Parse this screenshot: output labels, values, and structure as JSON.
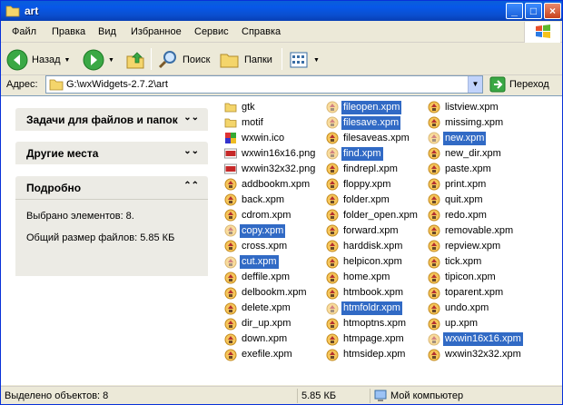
{
  "window": {
    "title": "art"
  },
  "menu": [
    "Файл",
    "Правка",
    "Вид",
    "Избранное",
    "Сервис",
    "Справка"
  ],
  "toolbar": {
    "back": "Назад",
    "search": "Поиск",
    "folders": "Папки"
  },
  "address": {
    "label": "Адрес:",
    "path": "G:\\wxWidgets-2.7.2\\art",
    "go": "Переход"
  },
  "taskpane": {
    "tasks": "Задачи для файлов и папок",
    "places": "Другие места",
    "details": "Подробно",
    "selected": "Выбрано элементов: 8.",
    "size": "Общий размер файлов: 5.85 КБ"
  },
  "files": {
    "col1": [
      {
        "name": "gtk",
        "type": "folder",
        "sel": false
      },
      {
        "name": "motif",
        "type": "folder",
        "sel": false
      },
      {
        "name": "wxwin.ico",
        "type": "ico",
        "sel": false
      },
      {
        "name": "wxwin16x16.png",
        "type": "png",
        "sel": false
      },
      {
        "name": "wxwin32x32.png",
        "type": "png",
        "sel": false
      },
      {
        "name": "addbookm.xpm",
        "type": "xpm",
        "sel": false
      },
      {
        "name": "back.xpm",
        "type": "xpm",
        "sel": false
      },
      {
        "name": "cdrom.xpm",
        "type": "xpm",
        "sel": false
      },
      {
        "name": "copy.xpm",
        "type": "xpm",
        "sel": true
      },
      {
        "name": "cross.xpm",
        "type": "xpm",
        "sel": false
      },
      {
        "name": "cut.xpm",
        "type": "xpm",
        "sel": true
      },
      {
        "name": "deffile.xpm",
        "type": "xpm",
        "sel": false
      },
      {
        "name": "delbookm.xpm",
        "type": "xpm",
        "sel": false
      },
      {
        "name": "delete.xpm",
        "type": "xpm",
        "sel": false
      },
      {
        "name": "dir_up.xpm",
        "type": "xpm",
        "sel": false
      },
      {
        "name": "down.xpm",
        "type": "xpm",
        "sel": false
      },
      {
        "name": "exefile.xpm",
        "type": "xpm",
        "sel": false
      }
    ],
    "col2": [
      {
        "name": "fileopen.xpm",
        "type": "xpm",
        "sel": true
      },
      {
        "name": "filesave.xpm",
        "type": "xpm",
        "sel": true
      },
      {
        "name": "filesaveas.xpm",
        "type": "xpm",
        "sel": false
      },
      {
        "name": "find.xpm",
        "type": "xpm",
        "sel": true
      },
      {
        "name": "findrepl.xpm",
        "type": "xpm",
        "sel": false
      },
      {
        "name": "floppy.xpm",
        "type": "xpm",
        "sel": false
      },
      {
        "name": "folder.xpm",
        "type": "xpm",
        "sel": false
      },
      {
        "name": "folder_open.xpm",
        "type": "xpm",
        "sel": false
      },
      {
        "name": "forward.xpm",
        "type": "xpm",
        "sel": false
      },
      {
        "name": "harddisk.xpm",
        "type": "xpm",
        "sel": false
      },
      {
        "name": "helpicon.xpm",
        "type": "xpm",
        "sel": false
      },
      {
        "name": "home.xpm",
        "type": "xpm",
        "sel": false
      },
      {
        "name": "htmbook.xpm",
        "type": "xpm",
        "sel": false
      },
      {
        "name": "htmfoldr.xpm",
        "type": "xpm",
        "sel": true
      },
      {
        "name": "htmoptns.xpm",
        "type": "xpm",
        "sel": false
      },
      {
        "name": "htmpage.xpm",
        "type": "xpm",
        "sel": false
      },
      {
        "name": "htmsidep.xpm",
        "type": "xpm",
        "sel": false
      }
    ],
    "col3": [
      {
        "name": "listview.xpm",
        "type": "xpm",
        "sel": false
      },
      {
        "name": "missimg.xpm",
        "type": "xpm",
        "sel": false
      },
      {
        "name": "new.xpm",
        "type": "xpm",
        "sel": true
      },
      {
        "name": "new_dir.xpm",
        "type": "xpm",
        "sel": false
      },
      {
        "name": "paste.xpm",
        "type": "xpm",
        "sel": false
      },
      {
        "name": "print.xpm",
        "type": "xpm",
        "sel": false
      },
      {
        "name": "quit.xpm",
        "type": "xpm",
        "sel": false
      },
      {
        "name": "redo.xpm",
        "type": "xpm",
        "sel": false
      },
      {
        "name": "removable.xpm",
        "type": "xpm",
        "sel": false
      },
      {
        "name": "repview.xpm",
        "type": "xpm",
        "sel": false
      },
      {
        "name": "tick.xpm",
        "type": "xpm",
        "sel": false
      },
      {
        "name": "tipicon.xpm",
        "type": "xpm",
        "sel": false
      },
      {
        "name": "toparent.xpm",
        "type": "xpm",
        "sel": false
      },
      {
        "name": "undo.xpm",
        "type": "xpm",
        "sel": false
      },
      {
        "name": "up.xpm",
        "type": "xpm",
        "sel": false
      },
      {
        "name": "wxwin16x16.xpm",
        "type": "xpm",
        "sel": true
      },
      {
        "name": "wxwin32x32.xpm",
        "type": "xpm",
        "sel": false
      }
    ]
  },
  "status": {
    "selected": "Выделено объектов: 8",
    "size": "5.85 КБ",
    "zone": "Мой компьютер"
  }
}
